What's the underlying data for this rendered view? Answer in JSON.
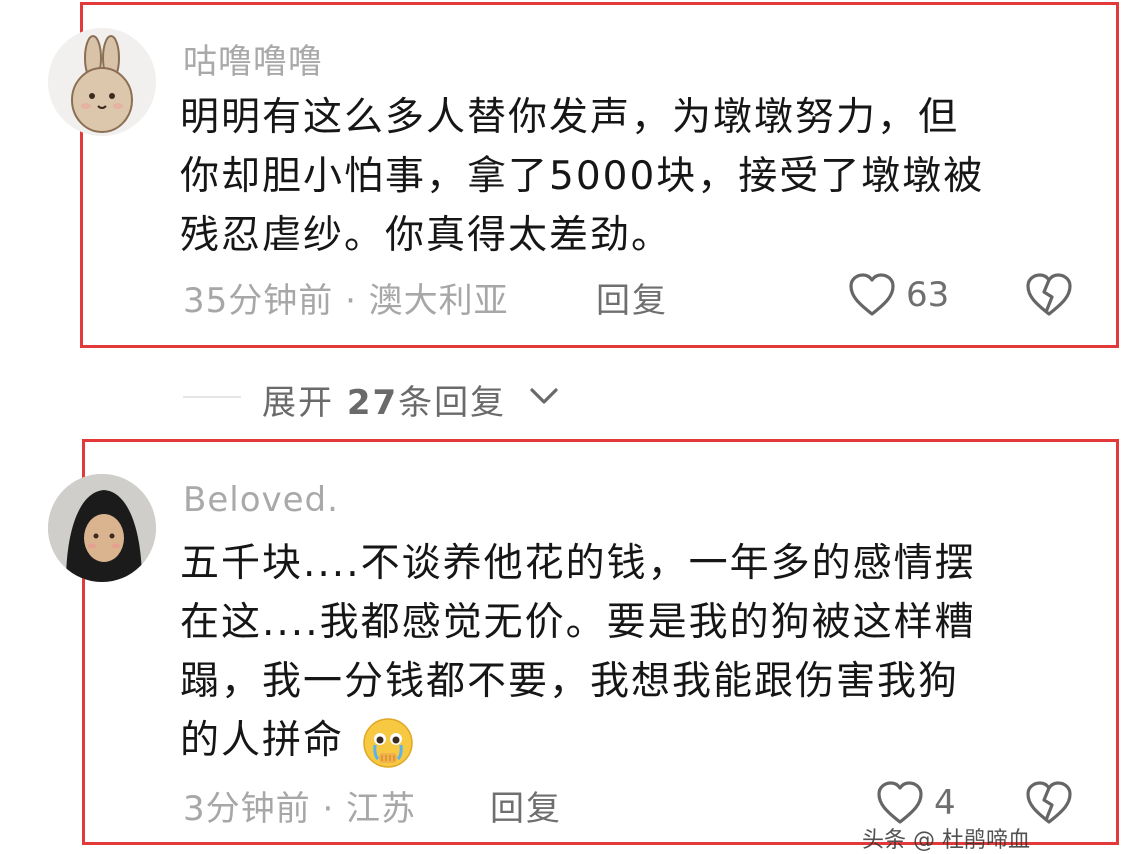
{
  "comments": [
    {
      "username": "咕噜噜噜",
      "content_lines": [
        "明明有这么多人替你发声，为墩墩努力，但",
        "你却胆小怕事，拿了5000块，接受了墩墩被",
        "残忍虐纱。你真得太差劲。"
      ],
      "meta": "35分钟前 · 澳大利亚",
      "reply_label": "回复",
      "likes": "63"
    },
    {
      "username": "Beloved.",
      "content_lines": [
        "五千块....不谈养他花的钱，一年多的感情摆",
        "在这....我都感觉无价。要是我的狗被这样糟",
        "蹋，我一分钱都不要，我想我能跟伤害我狗",
        "的人拼命"
      ],
      "meta": "3分钟前 · 江苏",
      "reply_label": "回复",
      "likes": "4"
    }
  ],
  "expand_replies": {
    "prefix": "展开",
    "count": "27",
    "suffix": "条回复"
  },
  "watermark": "头条 @ 杜鹃啼血"
}
